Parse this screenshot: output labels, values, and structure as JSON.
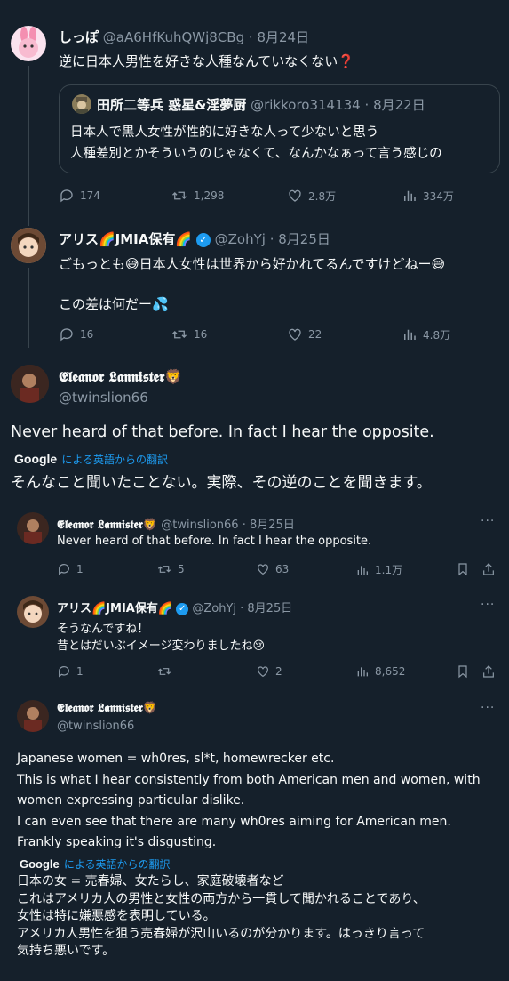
{
  "tweet1": {
    "name": "しっぽ",
    "handle": "@aA6HfKuhQWj8CBg",
    "date": "8月24日",
    "text": "逆に日本人男性を好きな人種なんていなくない❓",
    "quote": {
      "name": "田所二等兵 惑星&淫夢厨",
      "handle": "@rikkoro314134",
      "date": "8月22日",
      "line1": "日本人で黒人女性が性的に好きな人って少ないと思う",
      "line2": "人種差別とかそういうのじゃなくて、なんかなぁって言う感じの"
    },
    "stats": {
      "replies": "174",
      "retweets": "1,298",
      "likes": "2.8万",
      "views": "334万"
    }
  },
  "tweet2": {
    "name": "アリス🌈JMIA保有🌈",
    "handle": "@ZohYj",
    "date": "8月25日",
    "line1": "ごもっとも😅日本人女性は世界から好かれてるんですけどねー😅",
    "line2": "この差は何だー💦",
    "stats": {
      "replies": "16",
      "retweets": "16",
      "likes": "22",
      "views": "4.8万"
    }
  },
  "main": {
    "name": "𝕰𝖑𝖊𝖆𝖓𝖔𝖗 𝕷𝖆𝖓𝖓𝖎𝖘𝖙𝖊𝖗🦁",
    "handle": "@twinslion66",
    "text": "Never heard of that before. In fact I hear the opposite.",
    "google": "Google",
    "translate_label": "による英語からの翻訳",
    "translation": "そんなこと聞いたことない。実際、その逆のことを聞きます。"
  },
  "reply1": {
    "name": "𝕰𝖑𝖊𝖆𝖓𝖔𝖗 𝕷𝖆𝖓𝖓𝖎𝖘𝖙𝖊𝖗🦁",
    "handle": "@twinslion66",
    "date": "8月25日",
    "text": "Never heard of that before. In fact I hear the opposite.",
    "stats": {
      "replies": "1",
      "retweets": "5",
      "likes": "63",
      "views": "1.1万"
    }
  },
  "reply2": {
    "name": "アリス🌈JMIA保有🌈",
    "handle": "@ZohYj",
    "date": "8月25日",
    "line1": "そうなんですね！",
    "line2": "昔とはだいぶイメージ変わりましたね😢",
    "stats": {
      "replies": "1",
      "retweets": "",
      "likes": "2",
      "views": "8,652"
    }
  },
  "reply3": {
    "name": "𝕰𝖑𝖊𝖆𝖓𝖔𝖗 𝕷𝖆𝖓𝖓𝖎𝖘𝖙𝖊𝖗🦁",
    "handle": "@twinslion66",
    "en1": "Japanese women = wh0res, sl*t, homewrecker etc.",
    "en2": "This is what I hear consistently from both American men and women, with",
    "en3": "women expressing particular dislike.",
    "en4": "I can even see that there are many wh0res aiming for American men.",
    "en5": "Frankly speaking it's disgusting.",
    "google": "Google",
    "translate_label": "による英語からの翻訳",
    "jp1": "日本の女 = 売春婦、女たらし、家庭破壊者など",
    "jp2": "これはアメリカ人の男性と女性の両方から一貫して聞かれることであり、",
    "jp3": "女性は特に嫌悪感を表明している。",
    "jp4": "アメリカ人男性を狙う売春婦が沢山いるのが分かります。はっきり言って",
    "jp5": "気持ち悪いです。"
  },
  "more_label": "···",
  "colors": {
    "background": "#15202b",
    "text": "#f7f9f9",
    "muted": "#8b98a5",
    "accent": "#1d9bf0"
  }
}
